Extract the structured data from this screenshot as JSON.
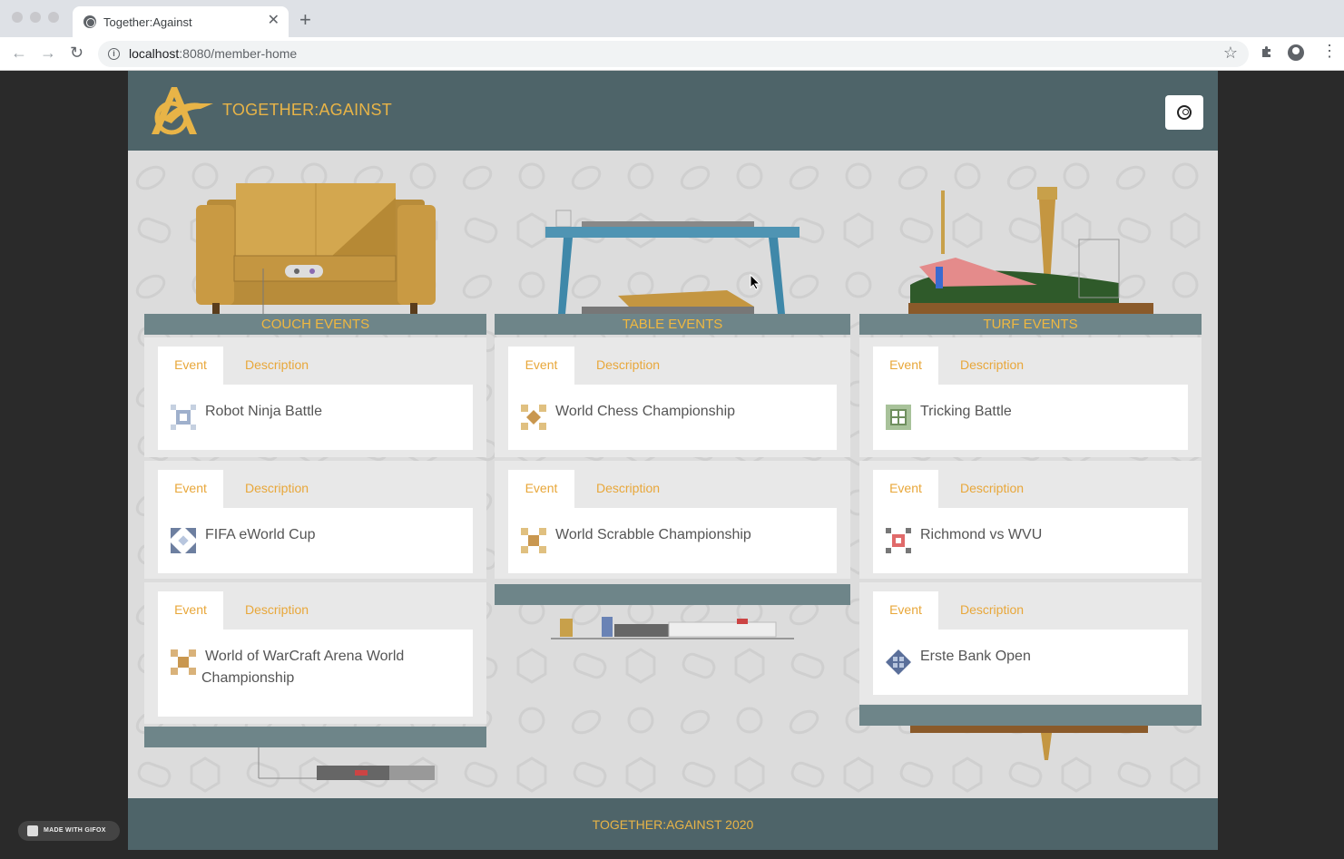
{
  "browser": {
    "tab_title": "Together:Against",
    "tab_close": "✕",
    "new_tab": "+",
    "url_host": "localhost",
    "url_path": ":8080/member-home"
  },
  "header": {
    "brand": "TOGETHER:AGAINST"
  },
  "columns": [
    {
      "title": "COUCH EVENTS",
      "events": [
        {
          "tab_event": "Event",
          "tab_description": "Description",
          "name": "Robot Ninja Battle"
        },
        {
          "tab_event": "Event",
          "tab_description": "Description",
          "name": "FIFA eWorld Cup"
        },
        {
          "tab_event": "Event",
          "tab_description": "Description",
          "name_line1": "World of WarCraft Arena World",
          "name_line2": "Championship"
        }
      ]
    },
    {
      "title": "TABLE EVENTS",
      "events": [
        {
          "tab_event": "Event",
          "tab_description": "Description",
          "name": "World Chess Championship"
        },
        {
          "tab_event": "Event",
          "tab_description": "Description",
          "name": "World Scrabble Championship"
        }
      ]
    },
    {
      "title": "TURF EVENTS",
      "events": [
        {
          "tab_event": "Event",
          "tab_description": "Description",
          "name": "Tricking Battle"
        },
        {
          "tab_event": "Event",
          "tab_description": "Description",
          "name": "Richmond vs WVU"
        },
        {
          "tab_event": "Event",
          "tab_description": "Description",
          "name": "Erste Bank Open"
        }
      ]
    }
  ],
  "footer": {
    "text": "TOGETHER:AGAINST 2020"
  },
  "watermark": "MADE WITH GIFOX",
  "colors": {
    "header_bg": "#4e6469",
    "accent": "#e8b447",
    "column_bar": "#6e8589"
  }
}
